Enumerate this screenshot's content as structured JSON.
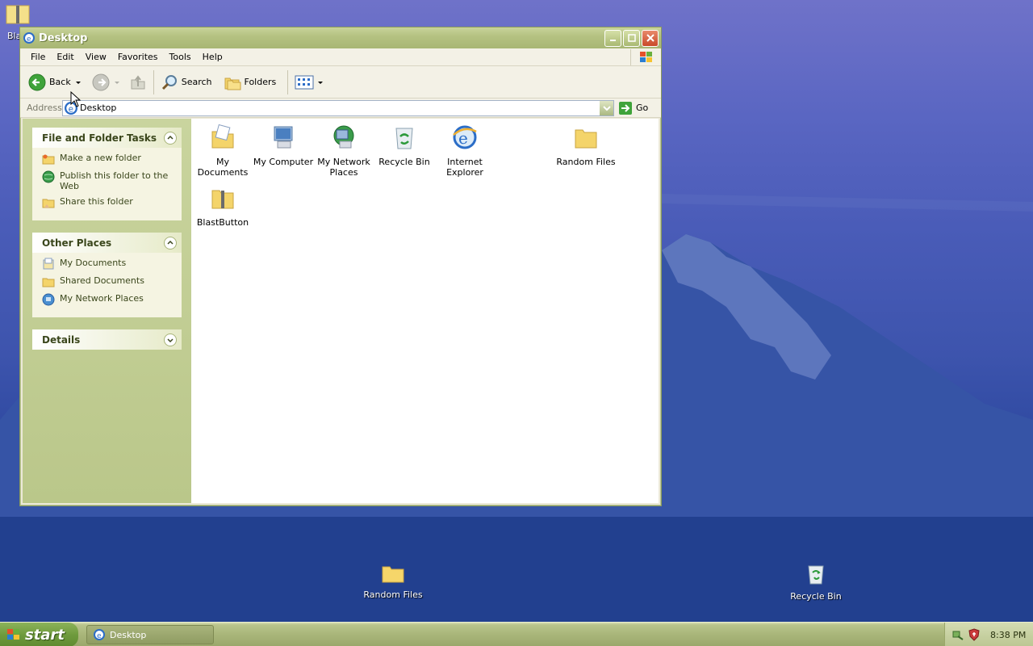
{
  "desktop": {
    "icons": [
      {
        "label": "Bla",
        "icon": "zip-folder-icon"
      },
      {
        "label": "Random Files",
        "icon": "folder-icon"
      },
      {
        "label": "Recycle Bin",
        "icon": "recycle-bin-icon"
      }
    ]
  },
  "window": {
    "title": "Desktop",
    "menu": [
      "File",
      "Edit",
      "View",
      "Favorites",
      "Tools",
      "Help"
    ],
    "toolbar": {
      "back_label": "Back",
      "search_label": "Search",
      "folders_label": "Folders"
    },
    "address": {
      "label": "Address",
      "value": "Desktop",
      "go_label": "Go"
    },
    "tasks": {
      "file_folder": {
        "title": "File and Folder Tasks",
        "items": [
          "Make a new folder",
          "Publish this folder to the Web",
          "Share this folder"
        ]
      },
      "other_places": {
        "title": "Other Places",
        "items": [
          "My Documents",
          "Shared Documents",
          "My Network Places"
        ]
      },
      "details": {
        "title": "Details"
      }
    },
    "files": [
      {
        "label": "My Documents",
        "icon": "my-documents-icon"
      },
      {
        "label": "My Computer",
        "icon": "my-computer-icon"
      },
      {
        "label": "My Network Places",
        "icon": "network-places-icon"
      },
      {
        "label": "Recycle Bin",
        "icon": "recycle-bin-icon"
      },
      {
        "label": "Internet Explorer",
        "icon": "internet-explorer-icon"
      },
      {
        "label": "Random Files",
        "icon": "folder-icon"
      },
      {
        "label": "BlastButton",
        "icon": "zip-folder-icon"
      }
    ]
  },
  "taskbar": {
    "start_label": "start",
    "task_item": "Desktop",
    "clock": "8:38 PM"
  },
  "colors": {
    "titlebar": "#b5c282",
    "taskpane": "#c9d49e",
    "desktop": "#3d54ad"
  }
}
